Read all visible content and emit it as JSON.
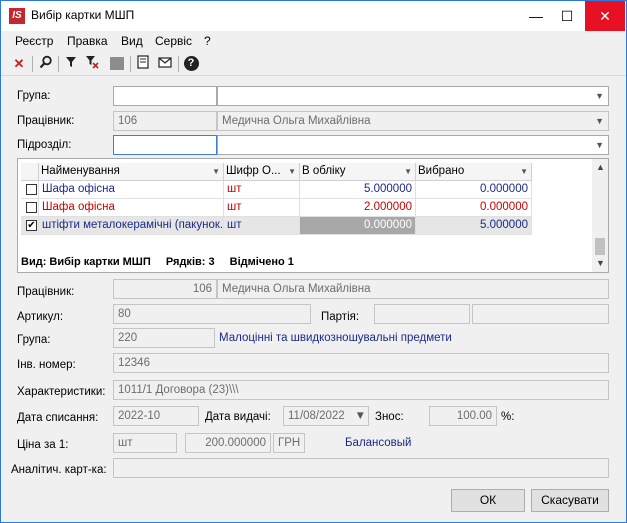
{
  "window": {
    "app_icon": "IS",
    "title": "Вибір картки МШП",
    "minimize": "—",
    "maximize": "☐",
    "close": "✕"
  },
  "menu": [
    "Реєстр",
    "Правка",
    "Вид",
    "Сервіс",
    "?"
  ],
  "toolbar_icons": [
    "delete-icon",
    "search-icon",
    "filter-icon",
    "clear-filter-icon",
    "disabled-icon",
    "document-icon",
    "mail-icon",
    "help-icon"
  ],
  "filter": {
    "group_label": "Група:",
    "group_value": "",
    "employee_label": "Працівник:",
    "employee_code": "106",
    "employee_name": "Медична Ольга Михайлівна",
    "department_label": "Підрозділ:",
    "department_value": ""
  },
  "grid": {
    "columns": [
      "Найменування",
      "Шифр О...",
      "В обліку",
      "Вибрано"
    ],
    "rows": [
      {
        "checked": false,
        "name": "Шафа офісна",
        "code": "шт",
        "in_account": "5.000000",
        "selected": "0.000000",
        "color": "#1a2a8a"
      },
      {
        "checked": false,
        "name": "Шафа офісна",
        "code": "шт",
        "in_account": "2.000000",
        "selected": "0.000000",
        "color": "#cc0000"
      },
      {
        "checked": true,
        "name": "штіфти металокерамічні (пакунок...",
        "code": "шт",
        "in_account": "0.000000",
        "selected": "5.000000",
        "color": "#1a2a8a"
      }
    ],
    "status_view": "Вид: Вибір картки МШП",
    "status_rows": "Рядків: 3",
    "status_marked": "Відмічено 1"
  },
  "details": {
    "employee_label": "Працівник:",
    "employee_code": "106",
    "employee_name": "Медична Ольга Михайлівна",
    "article_label": "Артикул:",
    "article_value": "80",
    "batch_label": "Партія:",
    "batch_value1": "",
    "batch_value2": "",
    "group_label": "Група:",
    "group_code": "220",
    "group_name": "Малоцінні та швидкозношувальні предмети",
    "inv_label": "Інв. номер:",
    "inv_value": "12346",
    "char_label": "Характеристики:",
    "char_value": "1011/1 Договора (23)\\\\\\",
    "writeoff_label": "Дата списання:",
    "writeoff_value": "2022-10",
    "issue_label": "Дата видачі:",
    "issue_value": "11/08/2022",
    "wear_label": "Знос:",
    "wear_value": "100.00",
    "wear_unit": "%:",
    "price_label": "Ціна за 1:",
    "price_unit": "шт",
    "price_value": "200.000000",
    "currency": "ГРН",
    "balance": "Балансовый",
    "analytic_label": "Аналітич. карт-ка:",
    "analytic_value": ""
  },
  "buttons": {
    "ok": "ОК",
    "cancel": "Скасувати"
  },
  "colors": {
    "accent": "#2b79d8",
    "close_bg": "#e81123",
    "red_row": "#cc0000",
    "blue_text": "#1a2a8a"
  }
}
